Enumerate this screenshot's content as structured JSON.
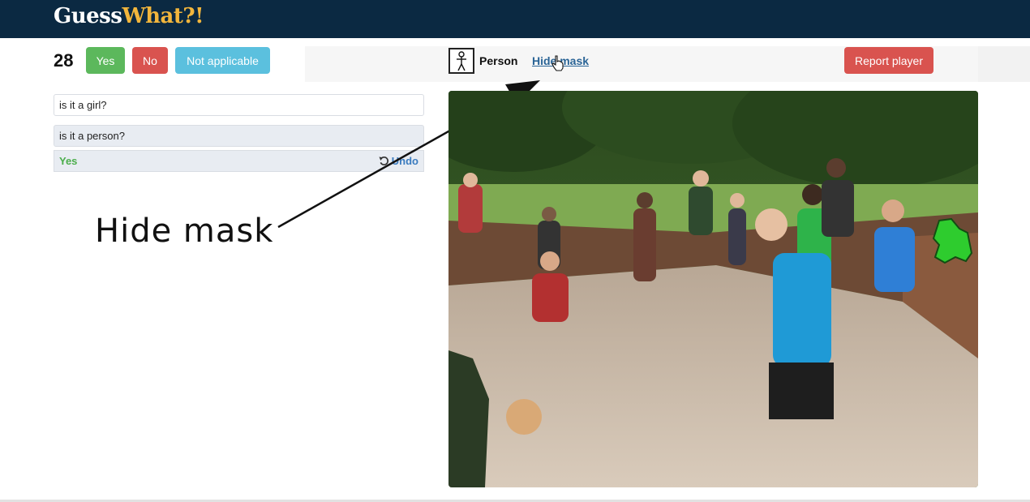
{
  "app": {
    "brand_part1": "Guess",
    "brand_part2": "What?!"
  },
  "game": {
    "question_count": "28",
    "buttons": {
      "yes": "Yes",
      "no": "No",
      "not_applicable": "Not applicable",
      "report": "Report player"
    },
    "target_category": "Person",
    "hide_mask_link": "Hide mask"
  },
  "dialogue": {
    "questions": [
      {
        "text": "is it a girl?"
      },
      {
        "text": "is it a person?"
      }
    ],
    "last_answer": "Yes",
    "undo_label": "Undo"
  },
  "annotation": {
    "callout_text": "Hide mask"
  },
  "colors": {
    "navbar": "#0b2942",
    "brand_accent": "#f2b63c",
    "yes": "#5cb85c",
    "no": "#d9534f",
    "not_applicable": "#5bc0de",
    "mask": "#2ecc2e"
  },
  "icons": [
    "person-icon",
    "undo-icon",
    "hand-cursor-icon"
  ]
}
